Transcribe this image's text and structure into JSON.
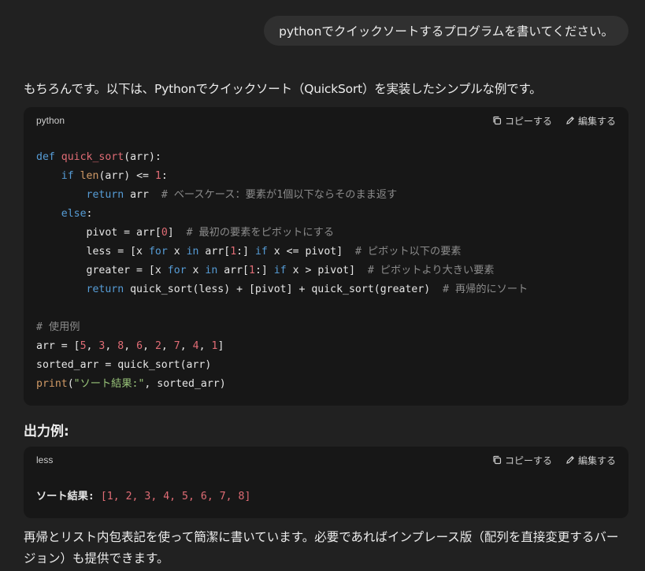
{
  "user_message": "pythonでクイックソートするプログラムを書いてください。",
  "assistant": {
    "intro": "もちろんです。以下は、Pythonでクイックソート（QuickSort）を実装したシンプルな例です。",
    "heading": "出力例:",
    "closing": "再帰とリスト内包表記を使って簡潔に書いています。必要であればインプレース版（配列を直接変更するバージョン）も提供できます。"
  },
  "code_block": {
    "language": "python",
    "copy_label": "コピーする",
    "edit_label": "編集する"
  },
  "output_block": {
    "language": "less",
    "copy_label": "コピーする",
    "edit_label": "編集する",
    "label": "ソート結果:",
    "value": "[1, 2, 3, 4, 5, 6, 7, 8]"
  },
  "code_lines": [
    "def quick_sort(arr):",
    "    if len(arr) <= 1:",
    "        return arr  # ベースケース：要素が1個以下ならそのまま返す",
    "    else:",
    "        pivot = arr[0]  # 最初の要素をピボットにする",
    "        less = [x for x in arr[1:] if x <= pivot]  # ピボット以下の要素",
    "        greater = [x for x in arr[1:] if x > pivot]  # ピボットより大きい要素",
    "        return quick_sort(less) + [pivot] + quick_sort(greater)  # 再帰的にソート",
    "",
    "# 使用例",
    "arr = [5, 3, 8, 6, 2, 7, 4, 1]",
    "sorted_arr = quick_sort(arr)",
    "print(\"ソート結果:\", sorted_arr)"
  ]
}
